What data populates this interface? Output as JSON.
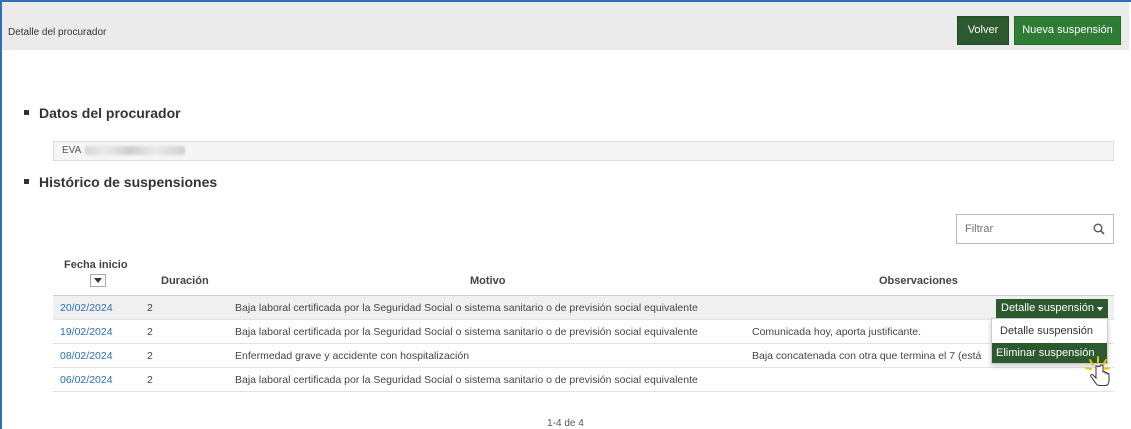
{
  "header": {
    "title": "Detalle del procurador",
    "back_label": "Volver",
    "new_label": "Nueva suspensión"
  },
  "sections": {
    "datos": "Datos del procurador",
    "historico": "Histórico de suspensiones"
  },
  "procurador": {
    "name_prefix": "EVA"
  },
  "filter": {
    "placeholder": "Filtrar"
  },
  "table": {
    "columns": {
      "fecha": "Fecha inicio",
      "duracion": "Duración",
      "motivo": "Motivo",
      "observaciones": "Observaciones"
    },
    "rows": [
      {
        "fecha": "20/02/2024",
        "duracion": "2",
        "motivo": "Baja laboral certificada por la Seguridad Social o sistema sanitario o de previsión social equivalente",
        "observaciones": ""
      },
      {
        "fecha": "19/02/2024",
        "duracion": "2",
        "motivo": "Baja laboral certificada por la Seguridad Social o sistema sanitario o de previsión social equivalente",
        "observaciones": "Comunicada hoy, aporta justificante."
      },
      {
        "fecha": "08/02/2024",
        "duracion": "2",
        "motivo": "Enfermedad grave y accidente con hospitalización",
        "observaciones": "Baja concatenada con otra que termina el 7 (está"
      },
      {
        "fecha": "06/02/2024",
        "duracion": "2",
        "motivo": "Baja laboral certificada por la Seguridad Social o sistema sanitario o de previsión social equivalente",
        "observaciones": ""
      }
    ],
    "row_menu": {
      "button_label": "Detalle suspensión",
      "items": [
        "Detalle suspensión",
        "Eliminar suspensión"
      ]
    }
  },
  "pager": {
    "text": "1-4 de 4"
  },
  "colors": {
    "primary": "#2c5a2e",
    "link": "#2a6fb3",
    "frame": "#2f6fb5"
  }
}
